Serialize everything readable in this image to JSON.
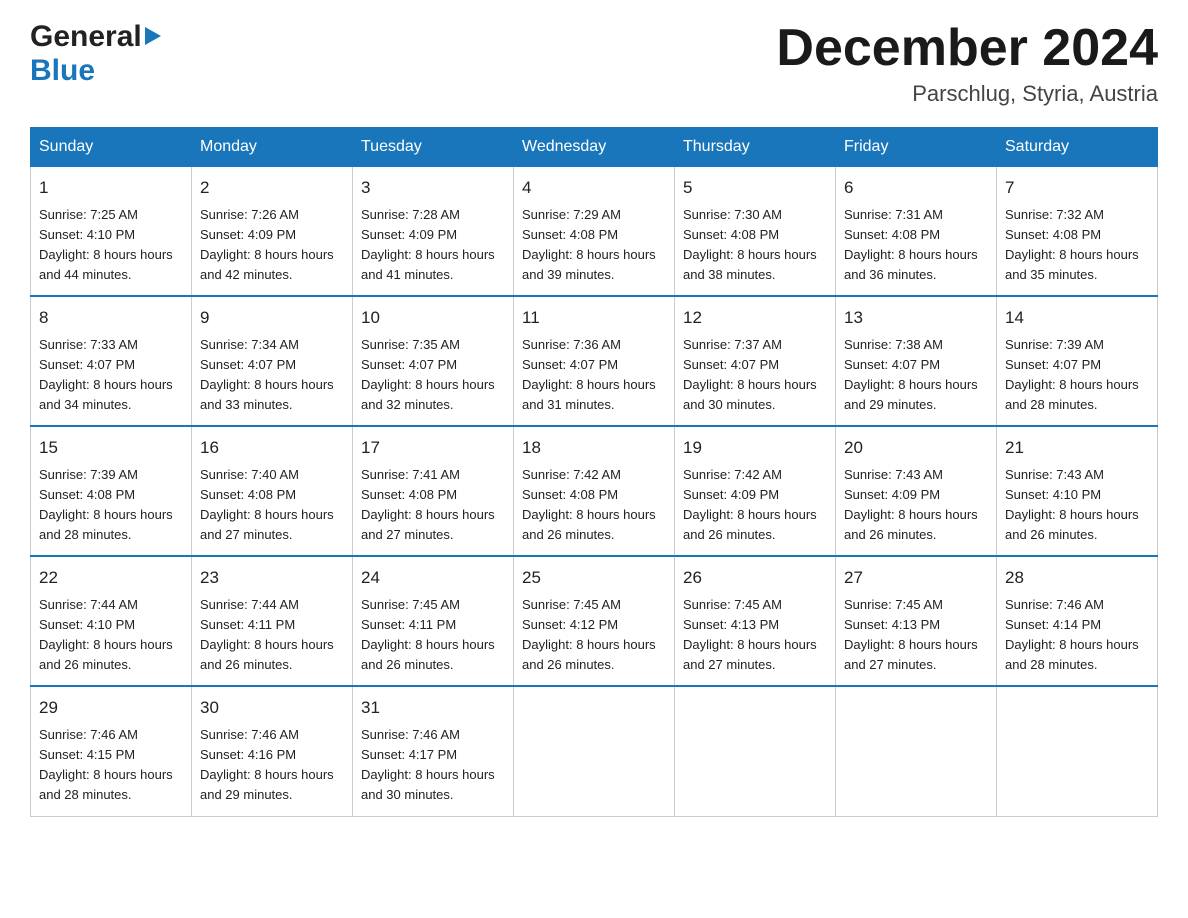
{
  "logo": {
    "general": "General",
    "blue": "Blue"
  },
  "header": {
    "month_year": "December 2024",
    "location": "Parschlug, Styria, Austria"
  },
  "weekdays": [
    "Sunday",
    "Monday",
    "Tuesday",
    "Wednesday",
    "Thursday",
    "Friday",
    "Saturday"
  ],
  "weeks": [
    [
      {
        "day": "1",
        "sunrise": "7:25 AM",
        "sunset": "4:10 PM",
        "daylight": "8 hours and 44 minutes."
      },
      {
        "day": "2",
        "sunrise": "7:26 AM",
        "sunset": "4:09 PM",
        "daylight": "8 hours and 42 minutes."
      },
      {
        "day": "3",
        "sunrise": "7:28 AM",
        "sunset": "4:09 PM",
        "daylight": "8 hours and 41 minutes."
      },
      {
        "day": "4",
        "sunrise": "7:29 AM",
        "sunset": "4:08 PM",
        "daylight": "8 hours and 39 minutes."
      },
      {
        "day": "5",
        "sunrise": "7:30 AM",
        "sunset": "4:08 PM",
        "daylight": "8 hours and 38 minutes."
      },
      {
        "day": "6",
        "sunrise": "7:31 AM",
        "sunset": "4:08 PM",
        "daylight": "8 hours and 36 minutes."
      },
      {
        "day": "7",
        "sunrise": "7:32 AM",
        "sunset": "4:08 PM",
        "daylight": "8 hours and 35 minutes."
      }
    ],
    [
      {
        "day": "8",
        "sunrise": "7:33 AM",
        "sunset": "4:07 PM",
        "daylight": "8 hours and 34 minutes."
      },
      {
        "day": "9",
        "sunrise": "7:34 AM",
        "sunset": "4:07 PM",
        "daylight": "8 hours and 33 minutes."
      },
      {
        "day": "10",
        "sunrise": "7:35 AM",
        "sunset": "4:07 PM",
        "daylight": "8 hours and 32 minutes."
      },
      {
        "day": "11",
        "sunrise": "7:36 AM",
        "sunset": "4:07 PM",
        "daylight": "8 hours and 31 minutes."
      },
      {
        "day": "12",
        "sunrise": "7:37 AM",
        "sunset": "4:07 PM",
        "daylight": "8 hours and 30 minutes."
      },
      {
        "day": "13",
        "sunrise": "7:38 AM",
        "sunset": "4:07 PM",
        "daylight": "8 hours and 29 minutes."
      },
      {
        "day": "14",
        "sunrise": "7:39 AM",
        "sunset": "4:07 PM",
        "daylight": "8 hours and 28 minutes."
      }
    ],
    [
      {
        "day": "15",
        "sunrise": "7:39 AM",
        "sunset": "4:08 PM",
        "daylight": "8 hours and 28 minutes."
      },
      {
        "day": "16",
        "sunrise": "7:40 AM",
        "sunset": "4:08 PM",
        "daylight": "8 hours and 27 minutes."
      },
      {
        "day": "17",
        "sunrise": "7:41 AM",
        "sunset": "4:08 PM",
        "daylight": "8 hours and 27 minutes."
      },
      {
        "day": "18",
        "sunrise": "7:42 AM",
        "sunset": "4:08 PM",
        "daylight": "8 hours and 26 minutes."
      },
      {
        "day": "19",
        "sunrise": "7:42 AM",
        "sunset": "4:09 PM",
        "daylight": "8 hours and 26 minutes."
      },
      {
        "day": "20",
        "sunrise": "7:43 AM",
        "sunset": "4:09 PM",
        "daylight": "8 hours and 26 minutes."
      },
      {
        "day": "21",
        "sunrise": "7:43 AM",
        "sunset": "4:10 PM",
        "daylight": "8 hours and 26 minutes."
      }
    ],
    [
      {
        "day": "22",
        "sunrise": "7:44 AM",
        "sunset": "4:10 PM",
        "daylight": "8 hours and 26 minutes."
      },
      {
        "day": "23",
        "sunrise": "7:44 AM",
        "sunset": "4:11 PM",
        "daylight": "8 hours and 26 minutes."
      },
      {
        "day": "24",
        "sunrise": "7:45 AM",
        "sunset": "4:11 PM",
        "daylight": "8 hours and 26 minutes."
      },
      {
        "day": "25",
        "sunrise": "7:45 AM",
        "sunset": "4:12 PM",
        "daylight": "8 hours and 26 minutes."
      },
      {
        "day": "26",
        "sunrise": "7:45 AM",
        "sunset": "4:13 PM",
        "daylight": "8 hours and 27 minutes."
      },
      {
        "day": "27",
        "sunrise": "7:45 AM",
        "sunset": "4:13 PM",
        "daylight": "8 hours and 27 minutes."
      },
      {
        "day": "28",
        "sunrise": "7:46 AM",
        "sunset": "4:14 PM",
        "daylight": "8 hours and 28 minutes."
      }
    ],
    [
      {
        "day": "29",
        "sunrise": "7:46 AM",
        "sunset": "4:15 PM",
        "daylight": "8 hours and 28 minutes."
      },
      {
        "day": "30",
        "sunrise": "7:46 AM",
        "sunset": "4:16 PM",
        "daylight": "8 hours and 29 minutes."
      },
      {
        "day": "31",
        "sunrise": "7:46 AM",
        "sunset": "4:17 PM",
        "daylight": "8 hours and 30 minutes."
      },
      null,
      null,
      null,
      null
    ]
  ],
  "labels": {
    "sunrise": "Sunrise: ",
    "sunset": "Sunset: ",
    "daylight": "Daylight: "
  }
}
